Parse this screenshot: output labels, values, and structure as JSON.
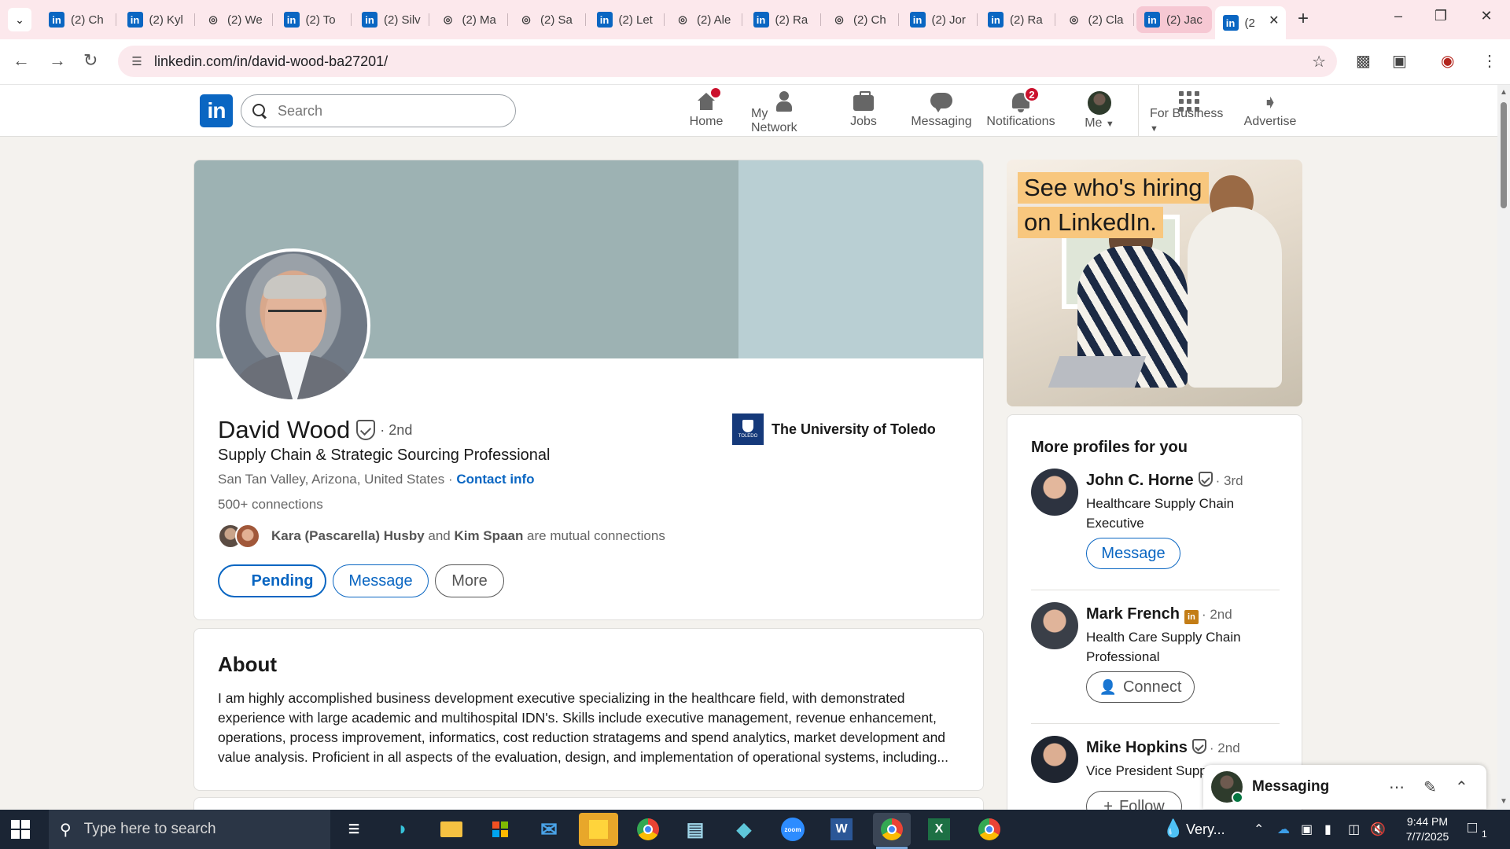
{
  "browser": {
    "tabs": [
      {
        "label": "(2) Ch",
        "icon": "linkedin-icon"
      },
      {
        "label": "(2) Kyl",
        "icon": "linkedin-icon"
      },
      {
        "label": "(2) We",
        "icon": "swirl-icon"
      },
      {
        "label": "(2) To",
        "icon": "linkedin-icon"
      },
      {
        "label": "(2) Silv",
        "icon": "linkedin-icon"
      },
      {
        "label": "(2) Ma",
        "icon": "swirl-icon"
      },
      {
        "label": "(2) Sa",
        "icon": "swirl-icon"
      },
      {
        "label": "(2) Let",
        "icon": "linkedin-icon"
      },
      {
        "label": "(2) Ale",
        "icon": "swirl-icon"
      },
      {
        "label": "(2) Ra",
        "icon": "linkedin-icon"
      },
      {
        "label": "(2) Ch",
        "icon": "swirl-icon"
      },
      {
        "label": "(2) Jor",
        "icon": "linkedin-icon"
      },
      {
        "label": "(2) Ra",
        "icon": "linkedin-icon"
      },
      {
        "label": "(2) Cla",
        "icon": "swirl-icon"
      },
      {
        "label": "(2) Jac",
        "icon": "linkedin-icon"
      },
      {
        "label": "(2",
        "icon": "linkedin-icon"
      }
    ],
    "url": "linkedin.com/in/david-wood-ba27201/"
  },
  "nav": {
    "search_placeholder": "Search",
    "home": "Home",
    "network": "My Network",
    "jobs": "Jobs",
    "messaging": "Messaging",
    "notifications": "Notifications",
    "notifications_count": "2",
    "me": "Me",
    "business": "For Business",
    "advertise": "Advertise"
  },
  "profile": {
    "name": "David Wood",
    "degree": "· 2nd",
    "headline": "Supply Chain & Strategic Sourcing Professional",
    "location": "San Tan Valley, Arizona, United States",
    "location_sep": " · ",
    "contact": "Contact info",
    "connections": "500+ connections",
    "mutual_1": "Kara (Pascarella) Husby",
    "mutual_and": " and ",
    "mutual_2": "Kim Spaan",
    "mutual_suffix": " are mutual connections",
    "education": "The University of Toledo",
    "edu_logo_text": "TOLEDO",
    "btn_pending": "Pending",
    "btn_message": "Message",
    "btn_more": "More"
  },
  "about": {
    "title": "About",
    "text": "I am highly accomplished business development executive specializing in the healthcare field, with demonstrated experience with large academic and multihospital IDN's. Skills include executive management, revenue enhancement, operations, process improvement, informatics, cost reduction stratagems and spend analytics, market development and value analysis. Proficient in all aspects of the evaluation, design, and implementation of operational systems, including..."
  },
  "ad": {
    "line1": "See who's hiring",
    "line2": "on LinkedIn."
  },
  "more_profiles": {
    "title": "More profiles for you",
    "people": [
      {
        "name": "John C. Horne",
        "degree": "· 3rd",
        "title": "Healthcare Supply Chain Executive",
        "action": "Message"
      },
      {
        "name": "Mark French",
        "degree": "· 2nd",
        "title": "Health Care Supply Chain Professional",
        "action": "Connect"
      },
      {
        "name": "Mike Hopkins",
        "degree": "· 2nd",
        "title": "Vice President Supp",
        "action": "Follow"
      }
    ]
  },
  "messaging_overlay": {
    "title": "Messaging"
  },
  "taskbar": {
    "search_placeholder": "Type here to search",
    "weather": "Very...",
    "time": "9:44 PM",
    "date": "7/7/2025",
    "notif_count": "1"
  }
}
